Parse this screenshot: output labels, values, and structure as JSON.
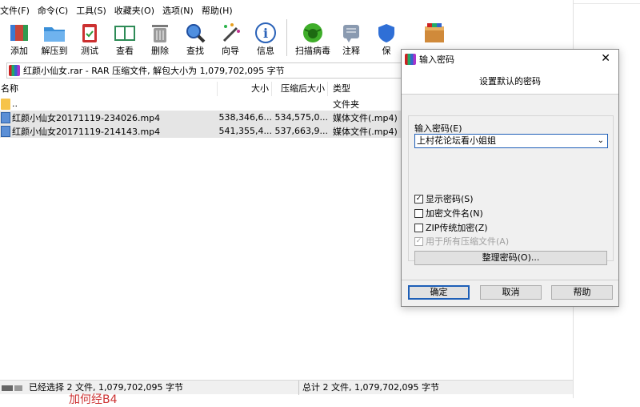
{
  "menu": [
    "文件(F)",
    "命令(C)",
    "工具(S)",
    "收藏夹(O)",
    "选项(N)",
    "帮助(H)"
  ],
  "toolbar": [
    {
      "label": "添加",
      "icon": "add-archive-icon",
      "color": "#c8463a"
    },
    {
      "label": "解压到",
      "icon": "extract-folder-icon",
      "color": "#3a8fd8"
    },
    {
      "label": "测试",
      "icon": "test-clipboard-icon",
      "color": "#cc3030"
    },
    {
      "label": "查看",
      "icon": "view-book-icon",
      "color": "#2e8b57"
    },
    {
      "label": "删除",
      "icon": "delete-trash-icon",
      "color": "#8a8a8a"
    },
    {
      "label": "查找",
      "icon": "find-magnifier-icon",
      "color": "#2f6fc2"
    },
    {
      "label": "向导",
      "icon": "wizard-wand-icon",
      "color": "#5a5a5a"
    },
    {
      "label": "信息",
      "icon": "info-icon",
      "color": "#2a62b8"
    },
    {
      "label": "扫描病毒",
      "icon": "virus-scan-icon",
      "color": "#3fae2a"
    },
    {
      "label": "注释",
      "icon": "comment-icon",
      "color": "#7a8aa0"
    },
    {
      "label": "保",
      "icon": "protect-shield-icon",
      "color": "#2f6fd6"
    },
    {
      "label": "",
      "icon": "sfx-box-icon",
      "color": "#d08a3a"
    }
  ],
  "address": "红颜小仙女.rar - RAR 压缩文件, 解包大小为 1,079,702,095 字节",
  "columns": {
    "name": "名称",
    "size": "大小",
    "packed": "压缩后大小",
    "type": "类型"
  },
  "rows": [
    {
      "name": "..",
      "size": "",
      "packed": "",
      "type": "文件夹",
      "kind": "folder",
      "selected": false
    },
    {
      "name": "红颜小仙女20171119-234026.mp4",
      "size": "538,346,6...",
      "packed": "534,575,0...",
      "type": "媒体文件(.mp4)",
      "kind": "video",
      "selected": true
    },
    {
      "name": "红颜小仙女20171119-214143.mp4",
      "size": "541,355,4...",
      "packed": "537,663,9...",
      "type": "媒体文件(.mp4)",
      "kind": "video",
      "selected": true
    }
  ],
  "status": {
    "left": "已经选择 2 文件, 1,079,702,095 字节",
    "right": "总计 2 文件, 1,079,702,095 字节"
  },
  "overflow_text": "加何经B4",
  "dialog": {
    "title": "输入密码",
    "header": "设置默认的密码",
    "pw_label": "输入密码(E)",
    "pw_value": "上村花论坛看小姐姐",
    "show_pw": "显示密码(S)",
    "encrypt_names": "加密文件名(N)",
    "zip_legacy": "ZIP传统加密(Z)",
    "all_archives": "用于所有压缩文件(A)",
    "organize": "整理密码(O)...",
    "ok": "确定",
    "cancel": "取消",
    "help": "帮助"
  }
}
